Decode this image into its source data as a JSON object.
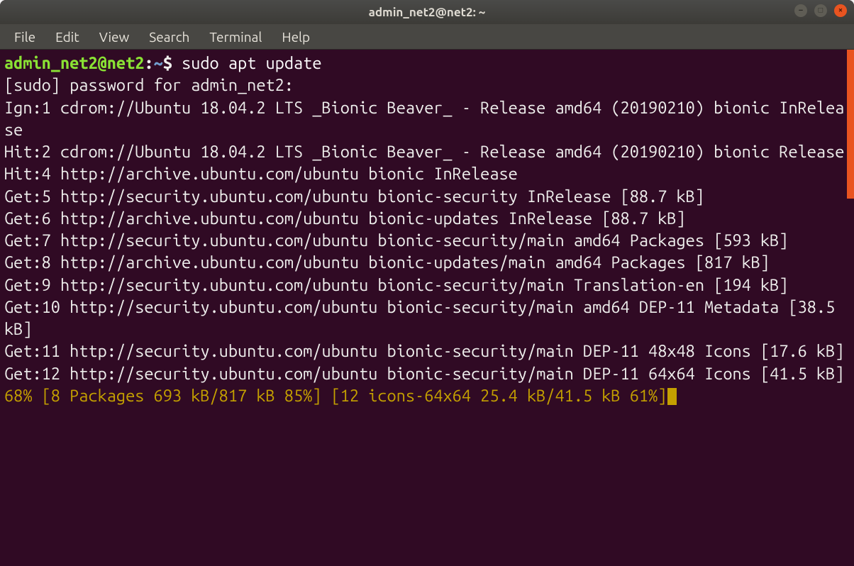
{
  "titlebar": {
    "title": "admin_net2@net2: ~",
    "controls": {
      "minimize": "–",
      "maximize": "□",
      "close": "×"
    }
  },
  "menu": {
    "file": "File",
    "edit": "Edit",
    "view": "View",
    "search": "Search",
    "terminal": "Terminal",
    "help": "Help"
  },
  "prompt": {
    "user_host": "admin_net2@net2",
    "separator": ":",
    "path": "~",
    "sigil": "$ "
  },
  "command": "sudo apt update",
  "lines": {
    "l01": "[sudo] password for admin_net2:",
    "l02": "Ign:1 cdrom://Ubuntu 18.04.2 LTS _Bionic Beaver_ - Release amd64 (20190210) bionic InRelease",
    "l03": "Hit:2 cdrom://Ubuntu 18.04.2 LTS _Bionic Beaver_ - Release amd64 (20190210) bionic Release",
    "l04": "Hit:4 http://archive.ubuntu.com/ubuntu bionic InRelease",
    "l05": "Get:5 http://security.ubuntu.com/ubuntu bionic-security InRelease [88.7 kB]",
    "l06": "Get:6 http://archive.ubuntu.com/ubuntu bionic-updates InRelease [88.7 kB]",
    "l07": "Get:7 http://security.ubuntu.com/ubuntu bionic-security/main amd64 Packages [593 kB]",
    "l08": "Get:8 http://archive.ubuntu.com/ubuntu bionic-updates/main amd64 Packages [817 kB]",
    "l09": "Get:9 http://security.ubuntu.com/ubuntu bionic-security/main Translation-en [194 kB]",
    "l10": "Get:10 http://security.ubuntu.com/ubuntu bionic-security/main amd64 DEP-11 Metadata [38.5 kB]",
    "l11": "Get:11 http://security.ubuntu.com/ubuntu bionic-security/main DEP-11 48x48 Icons [17.6 kB]",
    "l12": "Get:12 http://security.ubuntu.com/ubuntu bionic-security/main DEP-11 64x64 Icons [41.5 kB]"
  },
  "progress_line": "68% [8 Packages 693 kB/817 kB 85%] [12 icons-64x64 25.4 kB/41.5 kB 61%]"
}
